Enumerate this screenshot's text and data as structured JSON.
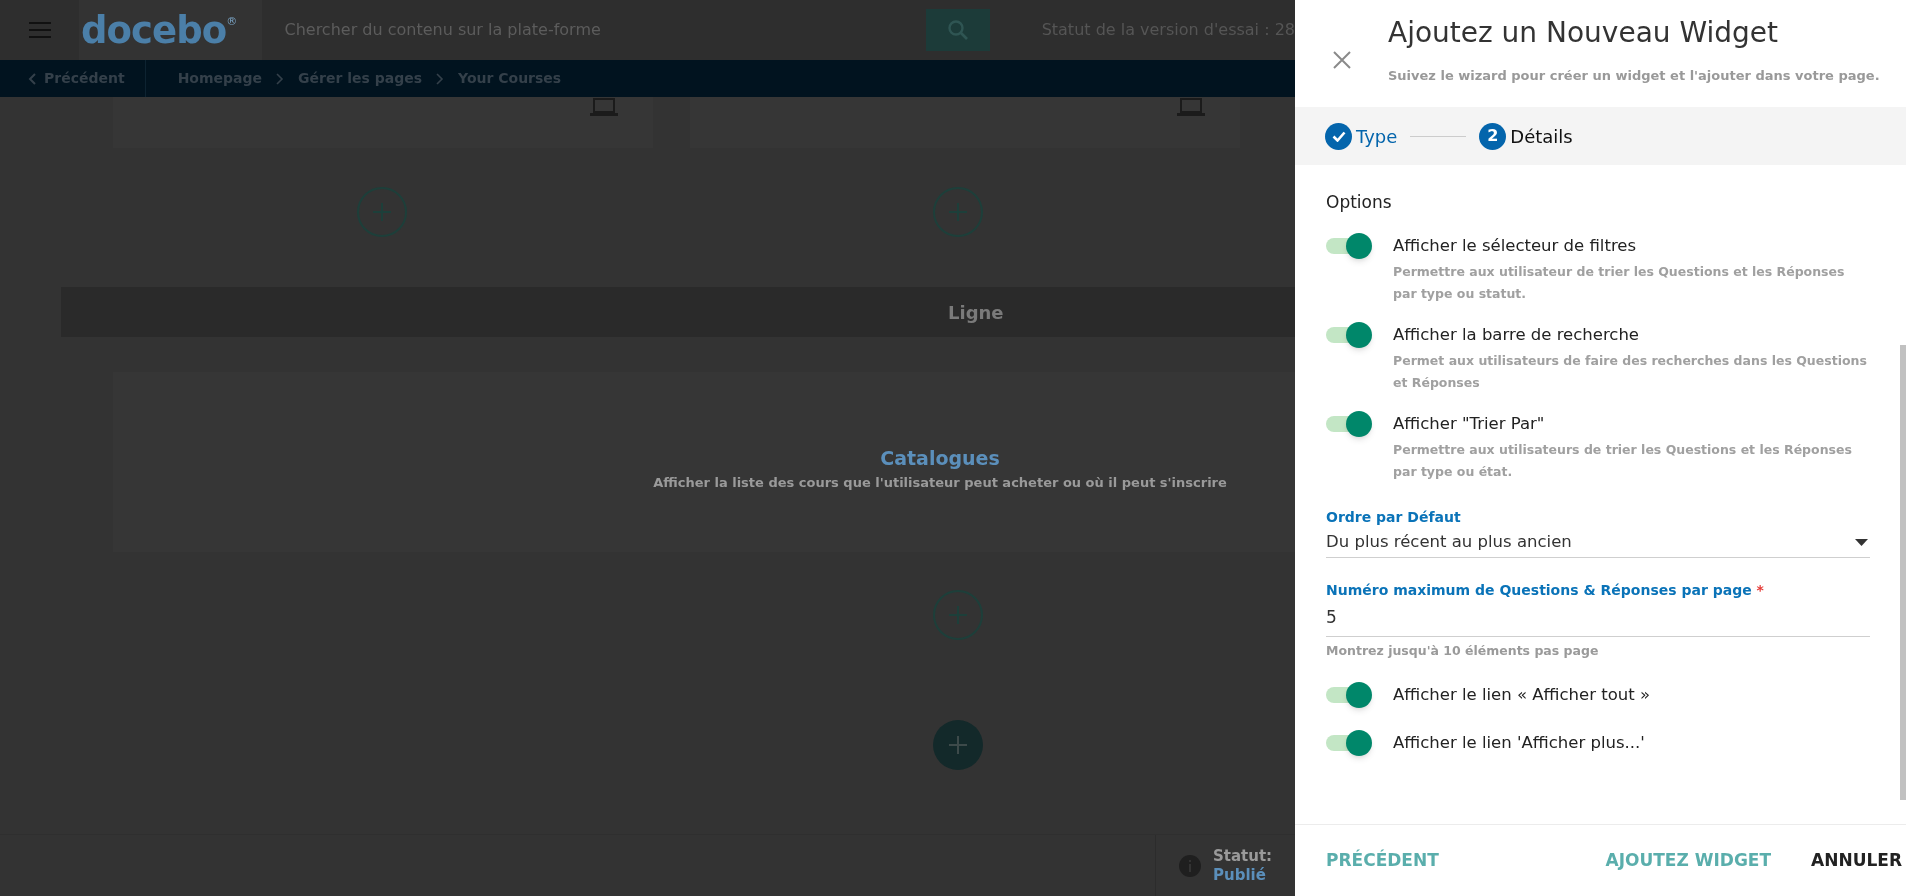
{
  "header": {
    "logo": "docebo",
    "logo_mark": "®",
    "search_placeholder": "Chercher du contenu sur la plate-forme",
    "trial_status": "Statut de la version d'essai : 28"
  },
  "breadcrumb": {
    "back": "Précédent",
    "items": [
      "Homepage",
      "Gérer les pages",
      "Your Courses"
    ]
  },
  "page": {
    "row_label": "Ligne",
    "catalog_title": "Catalogues",
    "catalog_description": "Afficher la liste des cours que l'utilisateur peut acheter ou où il peut s'inscrire",
    "status_label": "Statut:",
    "status_value": "Publié"
  },
  "panel": {
    "title": "Ajoutez un Nouveau Widget",
    "subtitle": "Suivez le wizard pour créer un widget et l'ajouter dans votre page.",
    "steps": [
      {
        "label": "Type",
        "completed": true,
        "selected": false
      },
      {
        "label": "Détails",
        "number": "2",
        "completed": false,
        "selected": true
      }
    ],
    "options_heading": "Options",
    "toggles": [
      {
        "label": "Afficher le sélecteur de filtres",
        "description": "Permettre aux utilisateur de trier les Questions et les Réponses par type ou statut.",
        "on": true
      },
      {
        "label": "Afficher la barre de recherche",
        "description": "Permet aux utilisateurs de faire des recherches dans les Questions et Réponses",
        "on": true
      },
      {
        "label": "Afficher \"Trier Par\"",
        "description": "Permettre aux utilisateurs de trier les Questions et les Réponses par type ou état.",
        "on": true
      }
    ],
    "sort_field": {
      "label": "Ordre par Défaut",
      "value": "Du plus récent au plus ancien"
    },
    "max_field": {
      "label": "Numéro maximum de Questions & Réponses par page",
      "required_mark": "*",
      "value": "5",
      "help": "Montrez jusqu'à 10 éléments pas page"
    },
    "link_toggles": [
      {
        "label": "Afficher le lien « Afficher tout »",
        "on": true
      },
      {
        "label": "Afficher le lien 'Afficher plus...'",
        "on": true
      }
    ],
    "buttons": {
      "previous": "PRÉCÉDENT",
      "add": "AJOUTEZ WIDGET",
      "cancel": "ANNULER"
    }
  }
}
